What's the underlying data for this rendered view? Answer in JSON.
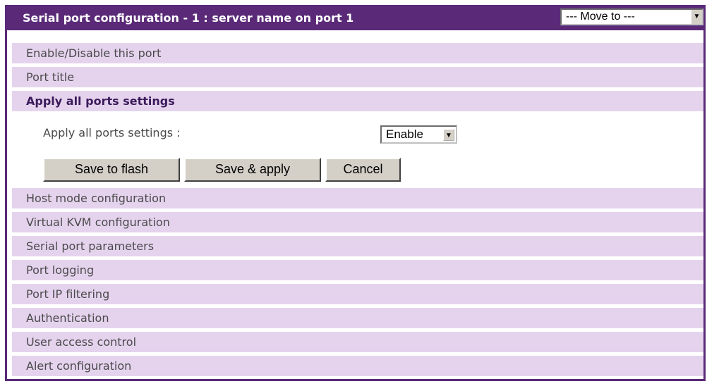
{
  "header": {
    "title": "Serial port configuration - 1 : server name on port 1",
    "move_to": "--- Move to ---"
  },
  "sections_top": [
    {
      "label": "Enable/Disable this port"
    },
    {
      "label": "Port title"
    },
    {
      "label": "Apply all ports settings"
    }
  ],
  "apply_settings": {
    "label": "Apply all ports settings :",
    "value": "Enable"
  },
  "buttons": {
    "save_flash": "Save to flash",
    "save_apply": "Save & apply",
    "cancel": "Cancel"
  },
  "sections_bottom": [
    {
      "label": "Host mode configuration"
    },
    {
      "label": "Virtual KVM configuration"
    },
    {
      "label": "Serial port parameters"
    },
    {
      "label": "Port logging"
    },
    {
      "label": "Port IP filtering"
    },
    {
      "label": "Authentication"
    },
    {
      "label": "User access control"
    },
    {
      "label": "Alert configuration"
    }
  ]
}
